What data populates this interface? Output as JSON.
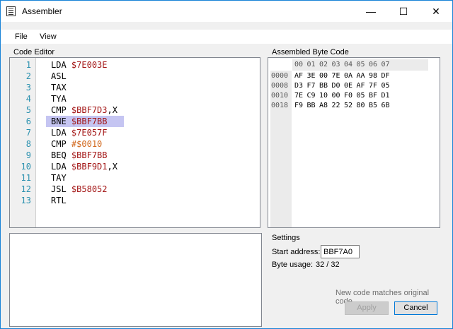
{
  "window": {
    "title": "Assembler",
    "controls": {
      "minimize": "—",
      "maximize": "☐",
      "close": "✕"
    }
  },
  "menu": [
    {
      "label": "File"
    },
    {
      "label": "View"
    }
  ],
  "code_editor": {
    "label": "Code Editor",
    "lines": [
      {
        "num": "1",
        "op": "LDA",
        "arg": "$7E003E",
        "suffix": ""
      },
      {
        "num": "2",
        "op": "ASL",
        "arg": "",
        "suffix": ""
      },
      {
        "num": "3",
        "op": "TAX",
        "arg": "",
        "suffix": ""
      },
      {
        "num": "4",
        "op": "TYA",
        "arg": "",
        "suffix": ""
      },
      {
        "num": "5",
        "op": "CMP",
        "arg": "$BBF7D3",
        "suffix": ",X"
      },
      {
        "num": "6",
        "op": "BNE",
        "arg": "$BBF7BB",
        "suffix": ""
      },
      {
        "num": "7",
        "op": "LDA",
        "arg": "$7E057F",
        "suffix": ""
      },
      {
        "num": "8",
        "op": "CMP",
        "arg": "#$0010",
        "suffix": ""
      },
      {
        "num": "9",
        "op": "BEQ",
        "arg": "$BBF7BB",
        "suffix": ""
      },
      {
        "num": "10",
        "op": "LDA",
        "arg": "$BBF9D1",
        "suffix": ",X"
      },
      {
        "num": "11",
        "op": "TAY",
        "arg": "",
        "suffix": ""
      },
      {
        "num": "12",
        "op": "JSL",
        "arg": "$B58052",
        "suffix": ""
      },
      {
        "num": "13",
        "op": "RTL",
        "arg": "",
        "suffix": ""
      }
    ],
    "highlighted_line": 6
  },
  "byte_code": {
    "label": "Assembled Byte Code",
    "columns": [
      "00",
      "01",
      "02",
      "03",
      "04",
      "05",
      "06",
      "07"
    ],
    "rows": [
      {
        "addr": "0000",
        "bytes": [
          "AF",
          "3E",
          "00",
          "7E",
          "0A",
          "AA",
          "98",
          "DF"
        ]
      },
      {
        "addr": "0008",
        "bytes": [
          "D3",
          "F7",
          "BB",
          "D0",
          "0E",
          "AF",
          "7F",
          "05"
        ]
      },
      {
        "addr": "0010",
        "bytes": [
          "7E",
          "C9",
          "10",
          "00",
          "F0",
          "05",
          "BF",
          "D1"
        ]
      },
      {
        "addr": "0018",
        "bytes": [
          "F9",
          "BB",
          "A8",
          "22",
          "52",
          "80",
          "B5",
          "6B"
        ]
      }
    ]
  },
  "settings": {
    "label": "Settings",
    "start_address_label": "Start address: $",
    "start_address_value": "BBF7A0",
    "byte_usage_label": "Byte usage:",
    "byte_usage_value": "32 / 32",
    "status": "New code matches original code",
    "apply_label": "Apply",
    "cancel_label": "Cancel"
  },
  "colors": {
    "line_number": "#2b91af",
    "operand": "#a31515",
    "immediate": "#d2691e",
    "highlight": "#c5c5f2"
  }
}
